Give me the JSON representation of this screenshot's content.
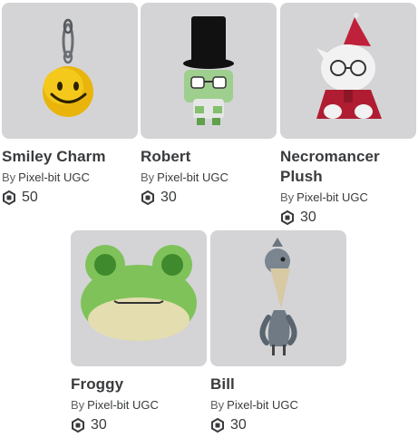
{
  "items": [
    {
      "name": "Smiley Charm",
      "by": "By",
      "creator": "Pixel-bit UGC",
      "price": "50",
      "icon": "robux-icon"
    },
    {
      "name": "Robert",
      "by": "By",
      "creator": "Pixel-bit UGC",
      "price": "30",
      "icon": "robux-icon"
    },
    {
      "name": "Necromancer Plush",
      "by": "By",
      "creator": "Pixel-bit UGC",
      "price": "30",
      "icon": "robux-icon"
    },
    {
      "name": "Froggy",
      "by": "By",
      "creator": "Pixel-bit UGC",
      "price": "30",
      "icon": "robux-icon"
    },
    {
      "name": "Bill",
      "by": "By",
      "creator": "Pixel-bit UGC",
      "price": "30",
      "icon": "robux-icon"
    }
  ],
  "colors": {
    "thumb_bg": "#d4d4d6",
    "text": "#393b3d",
    "muted": "#606264"
  }
}
